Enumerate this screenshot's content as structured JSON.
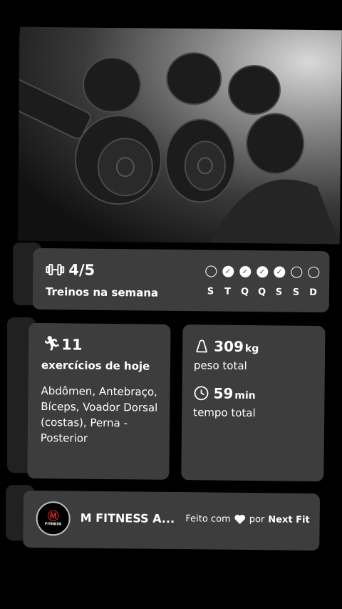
{
  "streak": {
    "count": "4/5",
    "label": "Treinos na semana",
    "days": [
      {
        "letter": "S",
        "done": false
      },
      {
        "letter": "T",
        "done": true
      },
      {
        "letter": "Q",
        "done": true
      },
      {
        "letter": "Q",
        "done": true
      },
      {
        "letter": "S",
        "done": true
      },
      {
        "letter": "S",
        "done": false
      },
      {
        "letter": "D",
        "done": false
      }
    ]
  },
  "exercises": {
    "count": "11",
    "label": "exercícios de hoje",
    "list": "Abdômen, Antebraço, Bíceps, Voador Dorsal (costas), Perna - Posterior"
  },
  "stats": {
    "weight_value": "309",
    "weight_unit": "kg",
    "weight_label": "peso total",
    "time_value": "59",
    "time_unit": "min",
    "time_label": "tempo total"
  },
  "footer": {
    "gym_name": "M FITNESS A...",
    "logo_text": "FITNESS",
    "made_with": "Feito com",
    "by": "por",
    "brand": "Next Fit"
  },
  "icons": {
    "streak": "dumbbell-icon",
    "exercises": "running-person-icon",
    "weight": "weight-icon",
    "time": "clock-icon",
    "heart": "heart-icon"
  }
}
